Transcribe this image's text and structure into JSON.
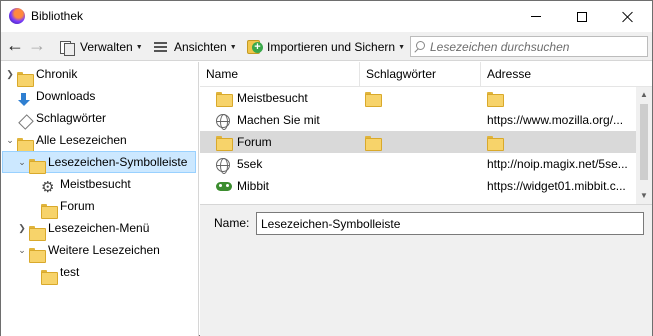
{
  "window": {
    "title": "Bibliothek"
  },
  "toolbar": {
    "organize_label": "Verwalten",
    "views_label": "Ansichten",
    "import_label": "Importieren und Sichern",
    "search_placeholder": "Lesezeichen durchsuchen"
  },
  "sidebar": {
    "items": [
      {
        "label": "Chronik",
        "icon": "folder-icon",
        "expanded": false
      },
      {
        "label": "Downloads",
        "icon": "download-icon"
      },
      {
        "label": "Schlagwörter",
        "icon": "tag-icon"
      },
      {
        "label": "Alle Lesezeichen",
        "icon": "folder-icon",
        "expanded": true
      },
      {
        "label": "Lesezeichen-Symbolleiste",
        "icon": "folder-icon",
        "expanded": true,
        "selected": true
      },
      {
        "label": "Meistbesucht",
        "icon": "gear-icon"
      },
      {
        "label": "Forum",
        "icon": "folder-icon"
      },
      {
        "label": "Lesezeichen-Menü",
        "icon": "folder-icon",
        "expanded": false
      },
      {
        "label": "Weitere Lesezeichen",
        "icon": "folder-icon",
        "expanded": true
      },
      {
        "label": "test",
        "icon": "folder-icon"
      }
    ]
  },
  "table": {
    "columns": [
      "Name",
      "Schlagwörter",
      "Adresse"
    ],
    "rows": [
      {
        "name": "Meistbesucht",
        "icon": "folder-icon",
        "tags_icon": true,
        "address": "",
        "address_icon": true
      },
      {
        "name": "Machen Sie mit",
        "icon": "globe-icon",
        "tags_icon": false,
        "address": "https://www.mozilla.org/...",
        "address_icon": false
      },
      {
        "name": "Forum",
        "icon": "folder-icon",
        "tags_icon": true,
        "address": "",
        "address_icon": true,
        "highlighted": true
      },
      {
        "name": "5sek",
        "icon": "globe-icon",
        "tags_icon": false,
        "address": "http://noip.magix.net/5se...",
        "address_icon": false
      },
      {
        "name": "Mibbit",
        "icon": "mibbit-icon",
        "tags_icon": false,
        "address": "https://widget01.mibbit.c...",
        "address_icon": false
      }
    ]
  },
  "details": {
    "name_label": "Name:",
    "name_value": "Lesezeichen-Symbolleiste"
  }
}
